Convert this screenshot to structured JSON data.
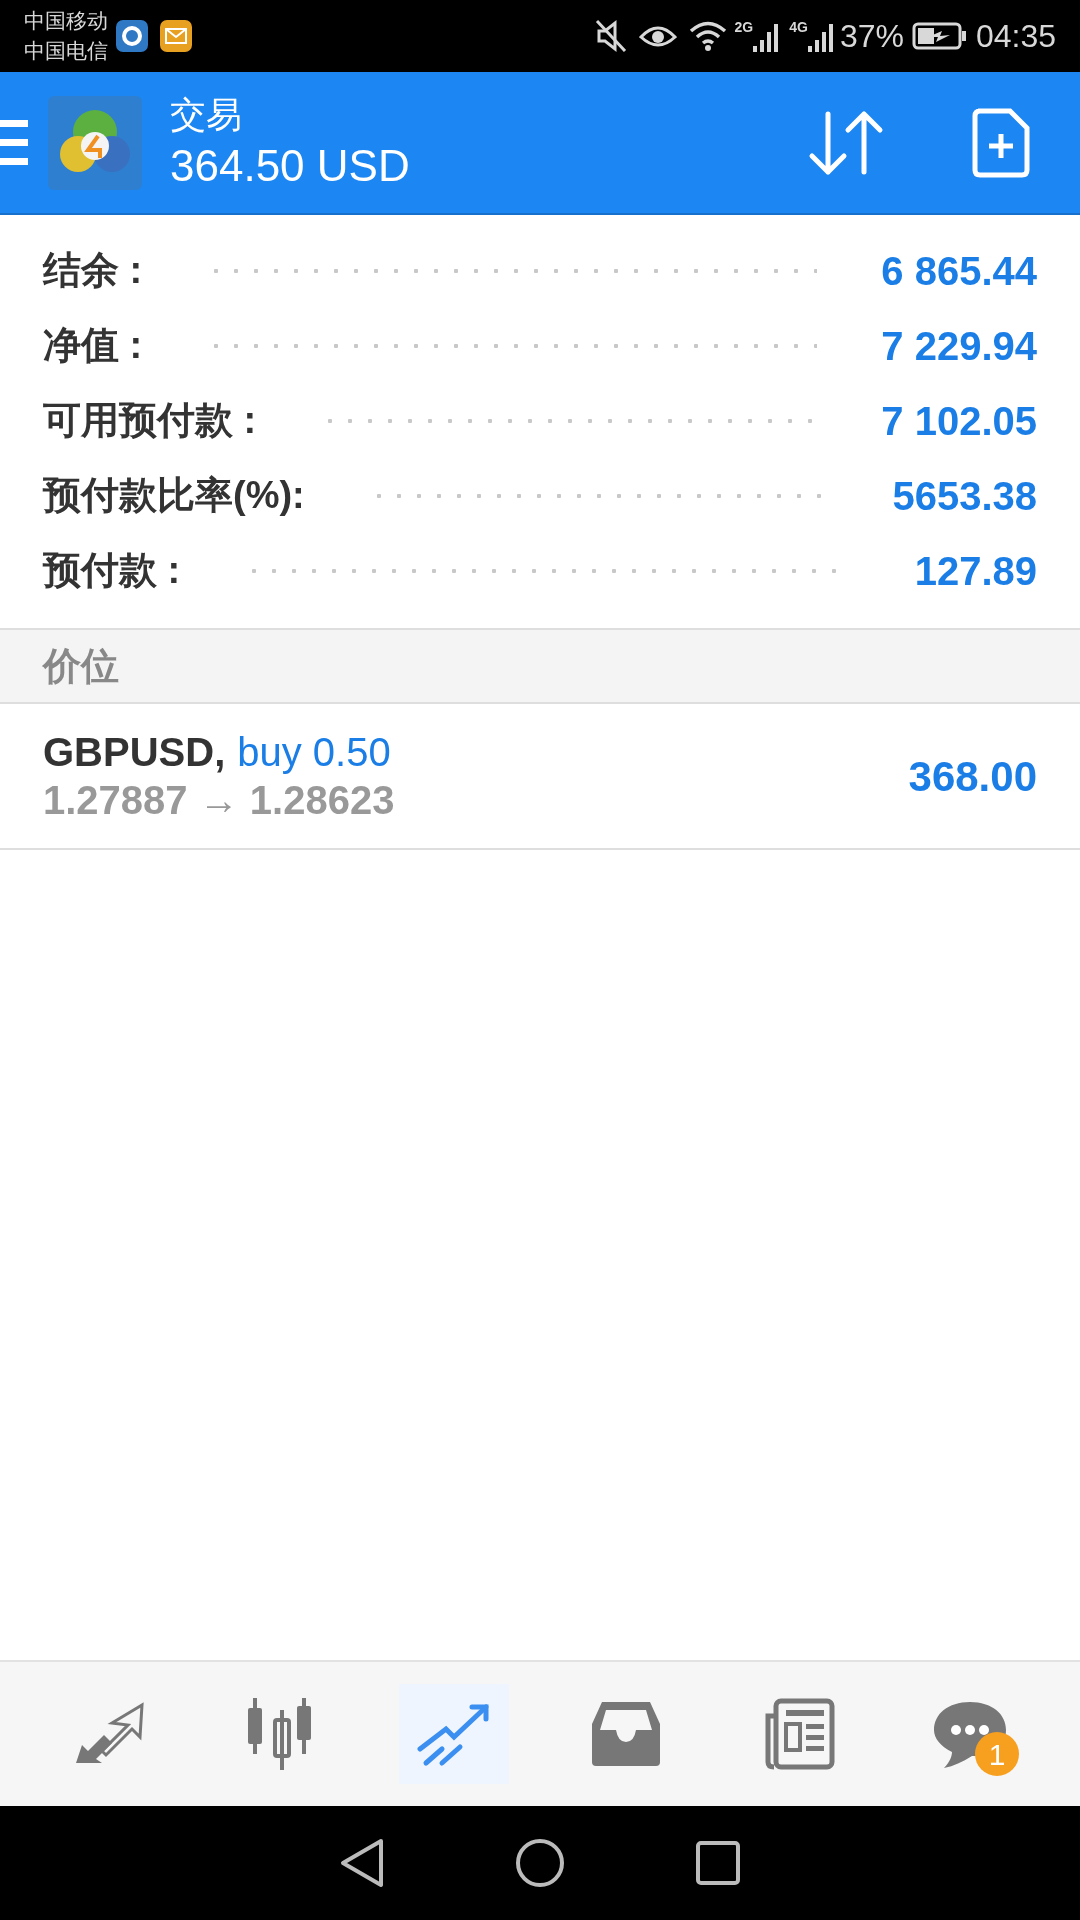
{
  "status_bar": {
    "carriers": [
      "中国移动",
      "中国电信"
    ],
    "network_labels": [
      "2G",
      "4G"
    ],
    "battery": "37%",
    "time": "04:35"
  },
  "header": {
    "title": "交易",
    "balance": "364.50 USD"
  },
  "summary": [
    {
      "label": "结余 :",
      "value": "6 865.44"
    },
    {
      "label": "净值 :",
      "value": "7 229.94"
    },
    {
      "label": "可用预付款 :",
      "value": "7 102.05"
    },
    {
      "label": "预付款比率(%):",
      "value": "5653.38"
    },
    {
      "label": "预付款 :",
      "value": "127.89"
    }
  ],
  "section": {
    "title": "价位"
  },
  "positions": [
    {
      "symbol": "GBPUSD,",
      "side": "buy 0.50",
      "prices": "1.27887 → 1.28623",
      "profit": "368.00"
    }
  ],
  "bottom_nav": [
    {
      "kind": "quotes",
      "selected": false
    },
    {
      "kind": "chart",
      "selected": false
    },
    {
      "kind": "trade",
      "selected": true
    },
    {
      "kind": "history",
      "selected": false
    },
    {
      "kind": "news",
      "selected": false
    },
    {
      "kind": "chat",
      "selected": false,
      "badge": "1"
    }
  ]
}
